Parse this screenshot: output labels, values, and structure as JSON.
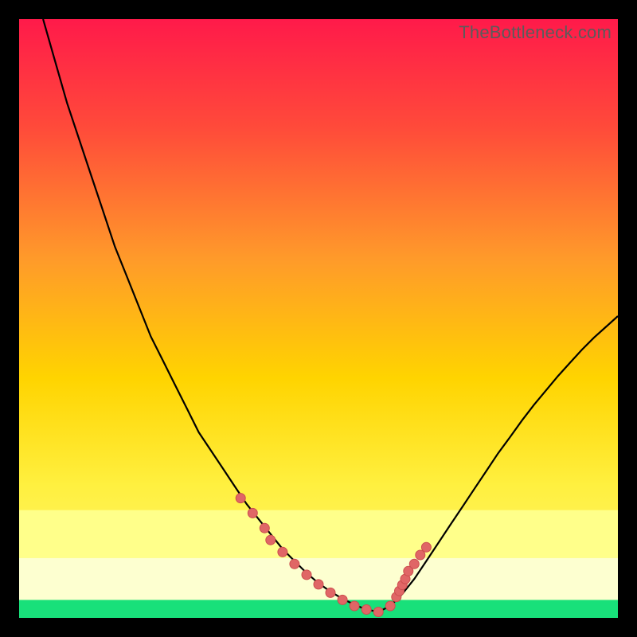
{
  "watermark": "TheBottleneck.com",
  "colors": {
    "bg": "#000000",
    "curve": "#000000",
    "marker_fill": "#e06666",
    "marker_stroke": "#cc4e4e",
    "grad_top": "#ff1a4a",
    "grad_mid_upper": "#ff7a2a",
    "grad_mid": "#ffe400",
    "grad_lower": "#ffff8a",
    "grad_pale": "#fdffd0",
    "grad_green": "#18e07a"
  },
  "chart_data": {
    "type": "line",
    "title": "",
    "xlabel": "",
    "ylabel": "",
    "xlim": [
      0,
      100
    ],
    "ylim": [
      0,
      100
    ],
    "series": [
      {
        "name": "bottleneck-curve",
        "x": [
          4,
          6,
          8,
          10,
          12,
          14,
          16,
          18,
          20,
          22,
          24,
          26,
          28,
          30,
          32,
          34,
          36,
          38,
          40,
          42,
          44,
          46,
          48,
          50,
          52,
          54,
          56,
          58,
          60,
          62,
          64,
          66,
          68,
          70,
          72,
          74,
          76,
          78,
          80,
          82,
          84,
          86,
          88,
          90,
          92,
          94,
          96,
          98,
          100
        ],
        "y": [
          100,
          93,
          86,
          80,
          74,
          68,
          62,
          57,
          52,
          47,
          43,
          39,
          35,
          31,
          28,
          25,
          22,
          19,
          16.5,
          14,
          11.5,
          9.5,
          7.5,
          5.8,
          4.4,
          3.2,
          2.2,
          1.4,
          1.0,
          2.0,
          4.0,
          6.5,
          9.5,
          12.5,
          15.5,
          18.5,
          21.5,
          24.5,
          27.5,
          30.2,
          33.0,
          35.6,
          38.0,
          40.4,
          42.6,
          44.8,
          46.8,
          48.6,
          50.4
        ]
      }
    ],
    "markers": {
      "name": "highlighted-points",
      "x": [
        37,
        39,
        41,
        42,
        44,
        46,
        48,
        50,
        52,
        54,
        56,
        58,
        60,
        62,
        63,
        63.5,
        64,
        64.5,
        65,
        66,
        67,
        68
      ],
      "y": [
        20,
        17.5,
        15,
        13,
        11,
        9.0,
        7.2,
        5.6,
        4.2,
        3.0,
        2.0,
        1.4,
        1.0,
        2.0,
        3.5,
        4.5,
        5.5,
        6.5,
        7.8,
        9.0,
        10.5,
        11.8
      ],
      "r": 6
    },
    "bands": [
      {
        "y0": 0,
        "y1": 3,
        "kind": "green"
      },
      {
        "y0": 3,
        "y1": 10,
        "kind": "pale"
      },
      {
        "y0": 10,
        "y1": 18,
        "kind": "lower"
      }
    ]
  }
}
